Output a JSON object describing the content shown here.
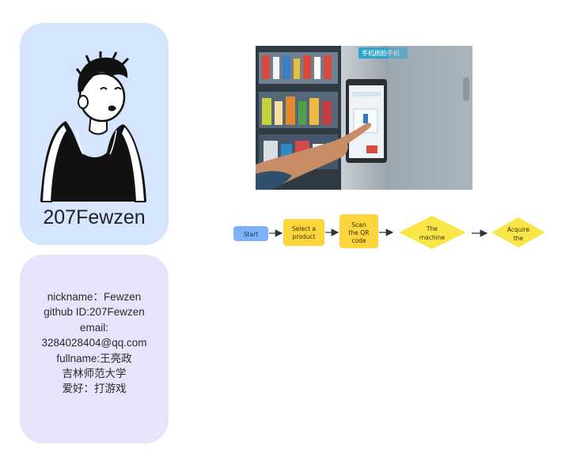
{
  "profile": {
    "username": "207Fewzen"
  },
  "info": {
    "lines": [
      "nickname：Fewzen",
      "github ID:207Fewzen",
      "email:",
      "3284028404@qq.com",
      "fullname:王亮政",
      "吉林师范大学",
      "爱好：打游戏"
    ]
  },
  "photo": {
    "sign_text": "手机刷脸手机"
  },
  "flowchart": {
    "nodes": [
      {
        "label_lines": [
          "Start"
        ],
        "shape": "rounded-rect",
        "color": "#7fb0f5"
      },
      {
        "label_lines": [
          "Select a",
          "product"
        ],
        "shape": "rounded-rect",
        "color": "#fbd53b"
      },
      {
        "label_lines": [
          "Scan",
          "the QR",
          "code"
        ],
        "shape": "rounded-rect",
        "color": "#fbd53b"
      },
      {
        "label_lines": [
          "The",
          "machine"
        ],
        "shape": "diamond",
        "color": "#fbe64a"
      },
      {
        "label_lines": [
          "Acquire",
          "the"
        ],
        "shape": "diamond",
        "color": "#fbe64a"
      }
    ]
  },
  "colors": {
    "profile_card": "#d4e5fd",
    "info_card": "#e6e4fb",
    "start_node": "#7fb0f5",
    "process_node": "#fbd53b",
    "decision_node": "#fbe64a"
  }
}
